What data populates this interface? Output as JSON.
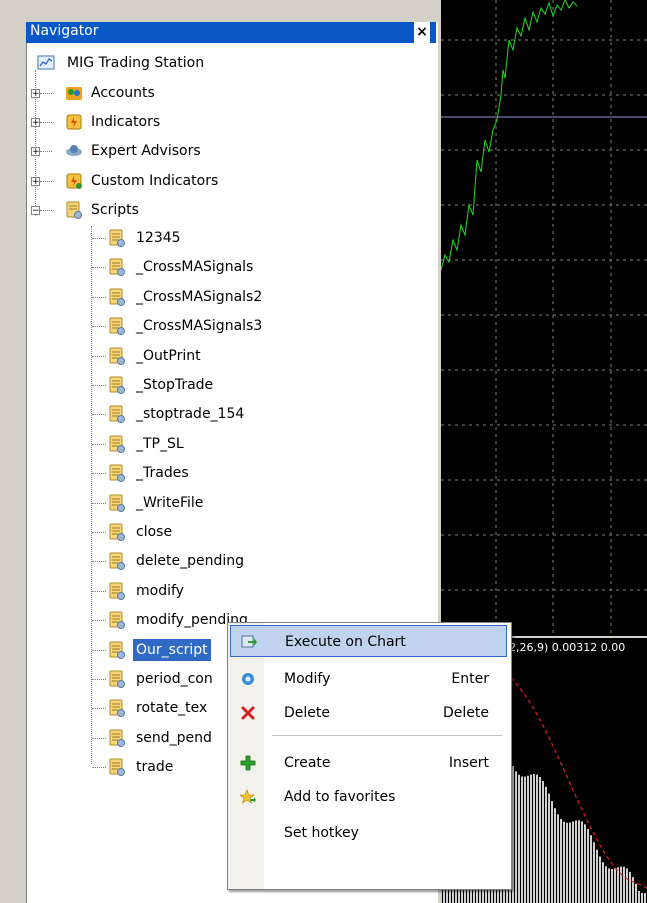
{
  "navigator": {
    "title": "Navigator",
    "close_glyph": "×",
    "root": "MIG Trading Station",
    "groups": [
      "Accounts",
      "Indicators",
      "Expert Advisors",
      "Custom Indicators",
      "Scripts"
    ],
    "scripts": [
      "12345",
      "_CrossMASignals",
      "_CrossMASignals2",
      "_CrossMASignals3",
      "_OutPrint",
      "_StopTrade",
      "_stoptrade_154",
      "_TP_SL",
      "_Trades",
      "_WriteFile",
      "close",
      "delete_pending",
      "modify",
      "modify_pending",
      "Our_script",
      "period_con",
      "rotate_tex",
      "send_pend",
      "trade"
    ],
    "selected": "Our_script"
  },
  "indicator": {
    "label": "2,26,9) 0.00312 0.00"
  },
  "context_menu": {
    "items": [
      {
        "label": "Execute on Chart",
        "shortcut": ""
      },
      {
        "label": "Modify",
        "shortcut": "Enter"
      },
      {
        "label": "Delete",
        "shortcut": "Delete"
      },
      {
        "label": "Create",
        "shortcut": "Insert"
      },
      {
        "label": "Add to favorites",
        "shortcut": ""
      },
      {
        "label": "Set hotkey",
        "shortcut": ""
      }
    ]
  },
  "colors": {
    "title_bar": "#0a58c8",
    "selection": "#316ac5",
    "price_line": "#22dd22"
  }
}
